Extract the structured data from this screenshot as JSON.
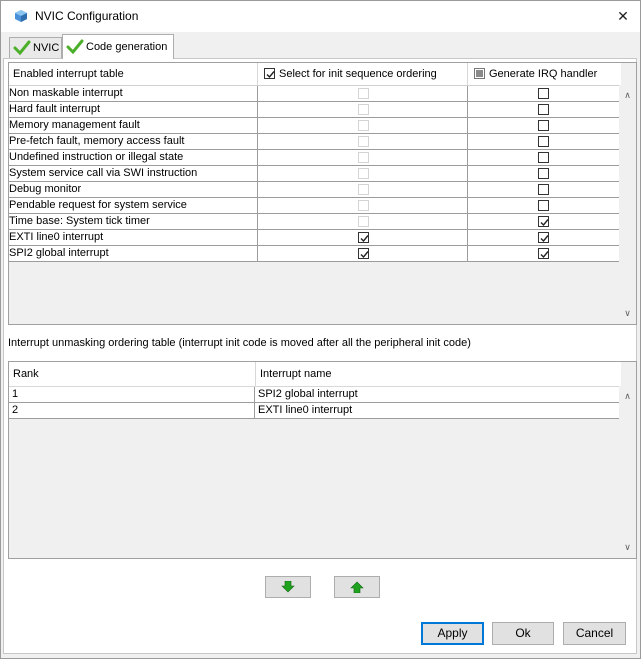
{
  "window": {
    "title": "NVIC Configuration",
    "close_glyph": "✕"
  },
  "tabs": [
    {
      "label": "NVIC",
      "icon": "check-icon",
      "active": false
    },
    {
      "label": "Code generation",
      "icon": "check-icon",
      "active": true
    }
  ],
  "enabled_table": {
    "header_name": "Enabled interrupt table",
    "header_init": "Select for init sequence ordering",
    "header_irq": "Generate IRQ handler",
    "rows": [
      {
        "name": "Non maskable interrupt",
        "init_checked": false,
        "init_enabled": false,
        "irq_checked": false
      },
      {
        "name": "Hard fault interrupt",
        "init_checked": false,
        "init_enabled": false,
        "irq_checked": false
      },
      {
        "name": "Memory management fault",
        "init_checked": false,
        "init_enabled": false,
        "irq_checked": false
      },
      {
        "name": "Pre-fetch fault, memory access fault",
        "init_checked": false,
        "init_enabled": false,
        "irq_checked": false
      },
      {
        "name": "Undefined instruction or illegal state",
        "init_checked": false,
        "init_enabled": false,
        "irq_checked": false
      },
      {
        "name": "System service call via SWI instruction",
        "init_checked": false,
        "init_enabled": false,
        "irq_checked": false
      },
      {
        "name": "Debug monitor",
        "init_checked": false,
        "init_enabled": false,
        "irq_checked": false
      },
      {
        "name": "Pendable request for system service",
        "init_checked": false,
        "init_enabled": false,
        "irq_checked": false
      },
      {
        "name": "Time base: System tick timer",
        "init_checked": false,
        "init_enabled": false,
        "irq_checked": true
      },
      {
        "name": "EXTI line0 interrupt",
        "init_checked": true,
        "init_enabled": true,
        "irq_checked": true
      },
      {
        "name": "SPI2 global interrupt",
        "init_checked": true,
        "init_enabled": true,
        "irq_checked": true
      }
    ]
  },
  "ordering_caption": "Interrupt unmasking ordering table (interrupt init code is moved after all the peripheral init code)",
  "ordering_table": {
    "header_rank": "Rank",
    "header_name": "Interrupt name",
    "rows": [
      {
        "rank": "1",
        "name": "SPI2 global interrupt"
      },
      {
        "rank": "2",
        "name": "EXTI line0 interrupt"
      }
    ]
  },
  "buttons": {
    "apply": "Apply",
    "ok": "Ok",
    "cancel": "Cancel"
  },
  "colors": {
    "arrow_green": "#1fa31f",
    "check_green": "#4caf2a",
    "accent": "#0078d7"
  }
}
